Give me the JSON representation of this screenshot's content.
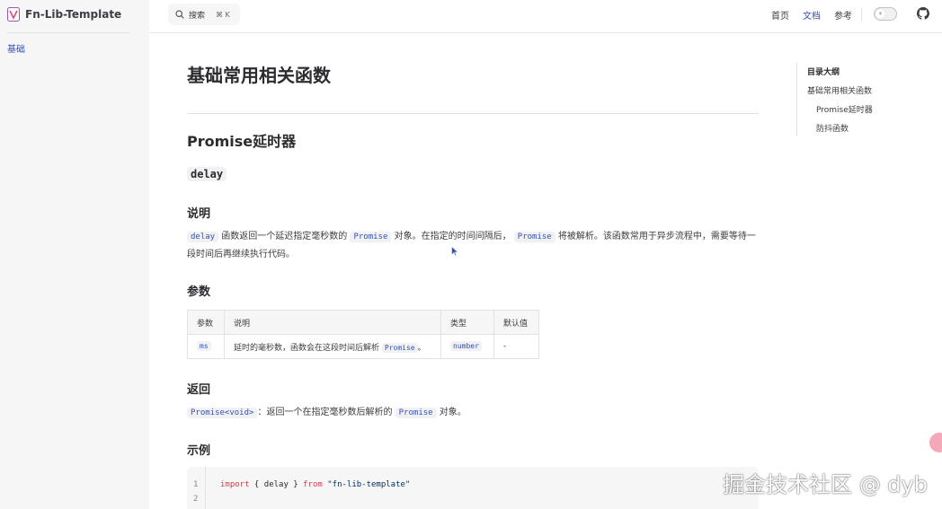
{
  "site": {
    "title": "Fn-Lib-Template"
  },
  "sidebar": {
    "items": [
      {
        "label": "基础"
      }
    ]
  },
  "topnav": {
    "search_label": "搜索",
    "search_shortcut": "⌘ K",
    "links": [
      {
        "label": "首页"
      },
      {
        "label": "文档"
      },
      {
        "label": "参考"
      }
    ]
  },
  "content": {
    "title": "基础常用相关函数",
    "section_title": "Promise延时器",
    "function_name": "delay",
    "desc_heading": "说明",
    "desc": {
      "code1": "delay",
      "t1": "函数返回一个延迟指定毫秒数的",
      "code2": "Promise",
      "t2": "对象。在指定的时间间隔后，",
      "code3": "Promise",
      "t3": "将被解析。该函数常用于异步流程中，需要等待一段时间后再继续执行代码。"
    },
    "params_heading": "参数",
    "params_table": {
      "headers": [
        "参数",
        "说明",
        "类型",
        "默认值"
      ],
      "rows": [
        {
          "name": "ms",
          "desc": "延时的毫秒数，函数会在这段时间后解析",
          "desc_code": "Promise",
          "desc_end": "。",
          "type": "number",
          "default": "-"
        }
      ]
    },
    "returns_heading": "返回",
    "returns": {
      "code1": "Promise<void>",
      "t1": "：返回一个在指定毫秒数后解析的",
      "code2": "Promise",
      "t2": "对象。"
    },
    "example_heading": "示例",
    "code_lines": [
      "1",
      "2"
    ],
    "code": {
      "import_kw": "import",
      "middle": " { delay } ",
      "from_kw": "from",
      "module": "\"fn-lib-template\""
    }
  },
  "outline": {
    "title": "目录大纲",
    "items": [
      {
        "label": "基础常用相关函数"
      },
      {
        "label": "Promise延时器"
      },
      {
        "label": "防抖函数"
      }
    ]
  },
  "watermark": "掘金技术社区 @ dyb",
  "colors": {
    "brand": "#3451b2",
    "sidebar_bg": "#f6f6f7",
    "text": "#3c3c43"
  }
}
